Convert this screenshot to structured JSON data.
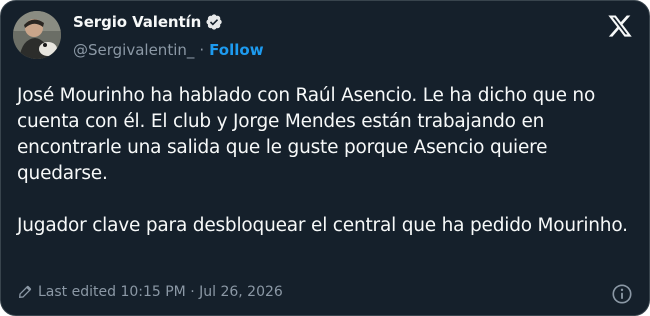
{
  "author": {
    "display_name": "Sergio Valentín",
    "handle": "@Sergivalentin_",
    "separator": "·",
    "follow_label": "Follow"
  },
  "tweet": {
    "paragraph_1": "José Mourinho ha hablado con Raúl Asencio. Le ha dicho que no cuenta con él. El club y Jorge Mendes están trabajando en encontrarle una salida que le guste porque Asencio quiere quedarse.",
    "paragraph_2": "Jugador clave para desbloquear el central que ha pedido Mourinho."
  },
  "footer": {
    "edited_label": "Last edited 10:15 PM · Jul 26, 2026"
  },
  "icons": {
    "verified": "verified-badge-icon",
    "platform": "x-logo-icon",
    "edit": "pencil-icon",
    "info": "info-icon"
  },
  "colors": {
    "background": "#15202b",
    "text": "#f7f9f9",
    "secondary_text": "#8b98a5",
    "accent": "#1d9bf0"
  }
}
